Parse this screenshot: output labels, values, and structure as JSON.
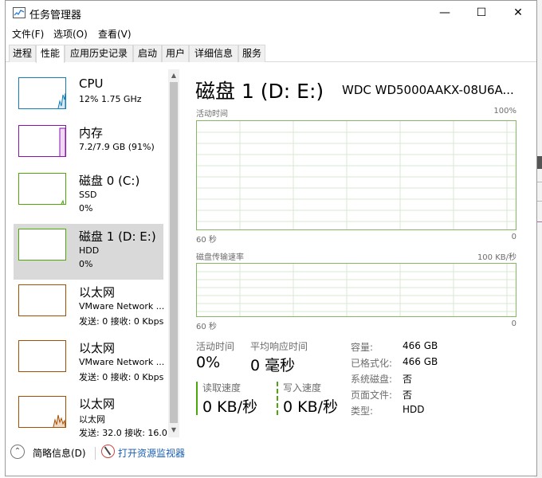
{
  "window": {
    "title": "任务管理器",
    "controls": {
      "minimize": "—",
      "maximize": "☐",
      "close": "✕"
    }
  },
  "menu": [
    "文件(F)",
    "选项(O)",
    "查看(V)"
  ],
  "tabs": [
    "进程",
    "性能",
    "应用历史记录",
    "启动",
    "用户",
    "详细信息",
    "服务"
  ],
  "active_tab": "性能",
  "colors": {
    "cpu": "#117dbb",
    "memory": "#8b12ae",
    "disk": "#4da60c",
    "ethernet": "#a74f01",
    "graph_grid": "#d9ead3"
  },
  "resources": [
    {
      "name": "CPU",
      "sub1": "12% 1.75 GHz",
      "sub2": ""
    },
    {
      "name": "内存",
      "sub1": "7.2/7.9 GB (91%)",
      "sub2": ""
    },
    {
      "name": "磁盘 0 (C:)",
      "sub1": "SSD",
      "sub2": "0%"
    },
    {
      "name": "磁盘 1 (D: E:)",
      "sub1": "HDD",
      "sub2": "0%"
    },
    {
      "name": "以太网",
      "sub1": "VMware Network ...",
      "sub2": "发送: 0 接收: 0 Kbps"
    },
    {
      "name": "以太网",
      "sub1": "VMware Network ...",
      "sub2": "发送: 0 接收: 0 Kbps"
    },
    {
      "name": "以太网",
      "sub1": "以太网",
      "sub2": "发送: 32.0 接收: 16.0 Kbps"
    }
  ],
  "selected_resource": "磁盘 1 (D: E:)",
  "detail": {
    "heading": "磁盘 1 (D: E:)",
    "model": "WDC WD5000AAKX-08U6A...",
    "graph1": {
      "label": "活动时间",
      "max": "100%",
      "time": "60 秒",
      "min": "0"
    },
    "graph2": {
      "label": "磁盘传输速率",
      "max": "100 KB/秒",
      "time": "60 秒",
      "min": "0"
    },
    "stats": {
      "active_time_label": "活动时间",
      "active_time_value": "0%",
      "response_label": "平均响应时间",
      "response_value": "0 毫秒",
      "read_label": "读取速度",
      "read_value": "0 KB/秒",
      "write_label": "写入速度",
      "write_value": "0 KB/秒"
    },
    "properties": [
      {
        "key": "容量:",
        "value": "466 GB"
      },
      {
        "key": "已格式化:",
        "value": "466 GB"
      },
      {
        "key": "系统磁盘:",
        "value": "否"
      },
      {
        "key": "页面文件:",
        "value": "否"
      },
      {
        "key": "类型:",
        "value": "HDD"
      }
    ]
  },
  "footer": {
    "fewer_details": "简略信息(D)",
    "open_monitor": "打开资源监视器"
  }
}
